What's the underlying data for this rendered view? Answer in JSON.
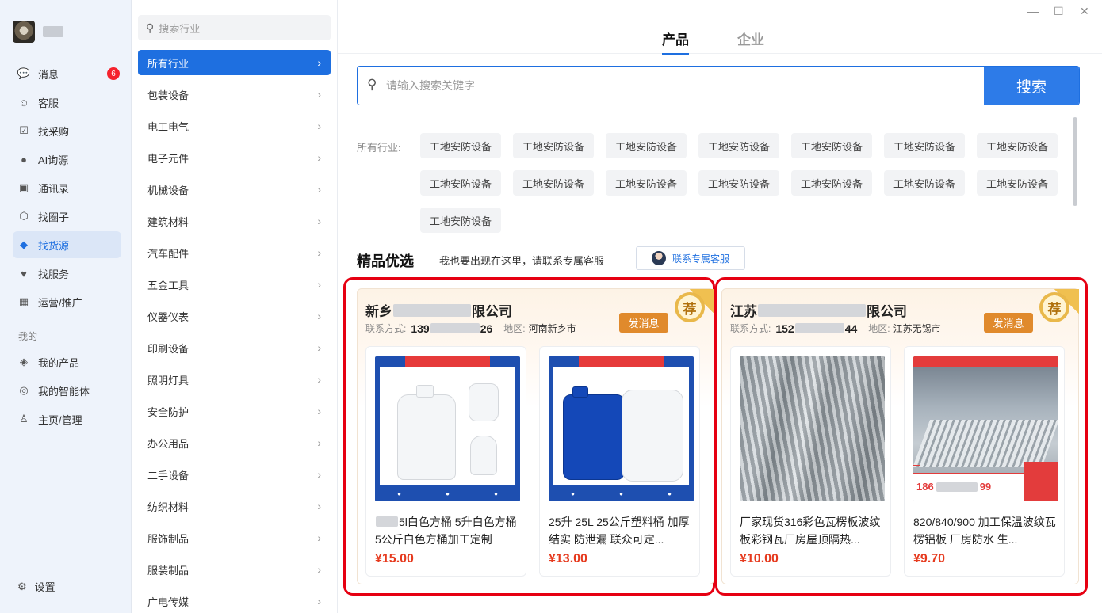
{
  "nav": {
    "items": [
      {
        "label": "消息",
        "icon": "chat-icon",
        "badge": "6"
      },
      {
        "label": "客服",
        "icon": "customer-service-icon"
      },
      {
        "label": "找采购",
        "icon": "purchase-icon"
      },
      {
        "label": "AI询源",
        "icon": "ai-chat-icon"
      },
      {
        "label": "通讯录",
        "icon": "contacts-icon"
      },
      {
        "label": "找圈子",
        "icon": "circle-icon"
      },
      {
        "label": "找货源",
        "icon": "cube-icon"
      },
      {
        "label": "找服务",
        "icon": "service-icon"
      },
      {
        "label": "运营/推广",
        "icon": "grid-icon"
      }
    ],
    "section_label": "我的",
    "my_items": [
      {
        "label": "我的产品",
        "icon": "layers-icon"
      },
      {
        "label": "我的智能体",
        "icon": "ai-agent-icon"
      },
      {
        "label": "主页/管理",
        "icon": "user-manage-icon"
      }
    ],
    "settings_label": "设置"
  },
  "categories": {
    "search_placeholder": "搜索行业",
    "items": [
      "所有行业",
      "包装设备",
      "电工电气",
      "电子元件",
      "机械设备",
      "建筑材料",
      "汽车配件",
      "五金工具",
      "仪器仪表",
      "印刷设备",
      "照明灯具",
      "安全防护",
      "办公用品",
      "二手设备",
      "纺织材料",
      "服饰制品",
      "服装制品",
      "广电传媒"
    ],
    "active_index": 0
  },
  "window": {
    "minimize": "—",
    "maximize": "☐",
    "close": "✕"
  },
  "tabs": [
    {
      "label": "产品",
      "active": true
    },
    {
      "label": "企业",
      "active": false
    }
  ],
  "search": {
    "placeholder": "请输入搜索关键字",
    "button": "搜索"
  },
  "industry": {
    "label": "所有行业:",
    "tags": [
      "工地安防设备",
      "工地安防设备",
      "工地安防设备",
      "工地安防设备",
      "工地安防设备",
      "工地安防设备",
      "工地安防设备",
      "工地安防设备",
      "工地安防设备",
      "工地安防设备",
      "工地安防设备",
      "工地安防设备",
      "工地安防设备",
      "工地安防设备",
      "工地安防设备"
    ]
  },
  "featured": {
    "title": "精品优选",
    "tip": "我也要出现在这里，请联系专属客服",
    "contact_button": "联系专属客服"
  },
  "companies": [
    {
      "name_start": "新乡",
      "name_end": "限公司",
      "contact_label": "联系方式:",
      "phone_start": "139",
      "phone_end": "26",
      "region_label": "地区:",
      "region": "河南新乡市",
      "message_button": "发消息",
      "rec_badge": "荐",
      "products": [
        {
          "title_prefix": "",
          "title": "5l白色方桶 5升白色方桶 5公斤白色方桶加工定制",
          "price": "¥15.00",
          "image": "white-jug"
        },
        {
          "title_prefix": "",
          "title": "25升 25L 25公斤塑料桶 加厚结实 防泄漏 联众可定...",
          "price": "¥13.00",
          "image": "blue-white-jug"
        }
      ]
    },
    {
      "name_start": "江苏",
      "name_end": "限公司",
      "contact_label": "联系方式:",
      "phone_start": "152",
      "phone_end": "44",
      "region_label": "地区:",
      "region": "江苏无锡市",
      "message_button": "发消息",
      "rec_badge": "荐",
      "products": [
        {
          "title": "厂家现货316彩色瓦楞板波纹板彩钢瓦厂房屋顶隔热...",
          "price": "¥10.00",
          "image": "steel-sheet"
        },
        {
          "title": "820/840/900 加工保温波纹瓦楞铝板 厂房防水 生...",
          "price": "¥9.70",
          "image": "factory-panels",
          "banner_phone_start": "186",
          "banner_phone_end": "99"
        }
      ]
    }
  ],
  "colors": {
    "accent": "#1e6fe0",
    "price": "#e63a1e",
    "highlight": "#e60012",
    "message": "#e08a2c"
  }
}
